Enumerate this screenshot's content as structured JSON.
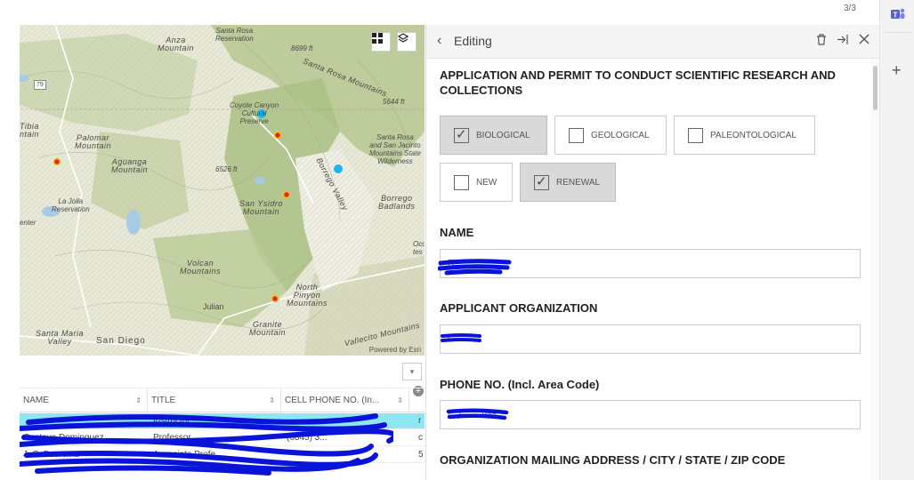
{
  "page_counter": "3/3",
  "map": {
    "labels": {
      "anza": "Anza\nMountain",
      "santa_rosa_res": "Santa Rosa\nReservation",
      "peak_8699": "8699 ft",
      "santa_rosa_mtns": "Santa Rosa Mountains",
      "peak_5644": "5644 ft",
      "route_79": "79",
      "coyote": "Coyote Canyon\nCultural\nPreserve",
      "tibia": "Tibia\nntain",
      "palomar": "Palomar\nMountain",
      "aguanga": "Aguanga\nMountain",
      "peak_6526": "6526 ft",
      "santa_rosa_state": "Santa Rosa\nand San Jacinto\nMountains State\nWilderness",
      "borrego_valley": "Borrego Valley",
      "borrego_badlands": "Borrego\nBadlands",
      "la_jolla": "La Jolla\nReservation",
      "san_ysidro": "San Ysidro\nMountain",
      "enter": "enter",
      "oco": "Oco\ntes",
      "volcan": "Volcan\nMountains",
      "julian": "Julian",
      "north_pinyon": "North\nPinyon\nMountains",
      "granite": "Granite\nMountain",
      "santa_maria": "Santa Maria\nValley",
      "san_diego": "San Diego",
      "vallecito": "Vallecito Mountains"
    },
    "attribution": "Powered by Esri",
    "grid_icon": "grid-icon",
    "layers_icon": "layers-icon"
  },
  "table": {
    "columns": [
      "NAME",
      "TITLE",
      "CELL PHONE NO. (In..."
    ],
    "rows": [
      {
        "name": "",
        "title": "Instructor",
        "phone": "",
        "extra": "r"
      },
      {
        "name": "Gustavo Dominguez",
        "title": "Professor",
        "phone": "(6845) 3...",
        "extra": "c"
      },
      {
        "name": "J. S. Boersma",
        "title": "Associate Profe...",
        "phone": "",
        "extra": "5"
      }
    ]
  },
  "panel": {
    "title": "Editing",
    "form_title": "APPLICATION AND PERMIT TO CONDUCT SCIENTIFIC RESEARCH AND COLLECTIONS",
    "checkboxes": [
      {
        "label": "BIOLOGICAL",
        "checked": true
      },
      {
        "label": "GEOLOGICAL",
        "checked": false
      },
      {
        "label": "PALEONTOLOGICAL",
        "checked": false
      },
      {
        "label": "NEW",
        "checked": false
      },
      {
        "label": "RENEWAL",
        "checked": true
      }
    ],
    "fields": [
      {
        "label": "NAME",
        "value": "R"
      },
      {
        "label": "APPLICANT ORGANIZATION",
        "value": "C"
      },
      {
        "label": "PHONE NO. (Incl. Area Code)",
        "value": "(...)-...-...958"
      },
      {
        "label": "ORGANIZATION MAILING ADDRESS / CITY / STATE / ZIP CODE",
        "value": ""
      }
    ]
  },
  "colors": {
    "selected_row": "#8fe6f3",
    "redaction": "#0a14d8",
    "point_fill": "#e7252a",
    "point_ring": "#f0c419",
    "highlight_point": "#1ab8f0"
  }
}
